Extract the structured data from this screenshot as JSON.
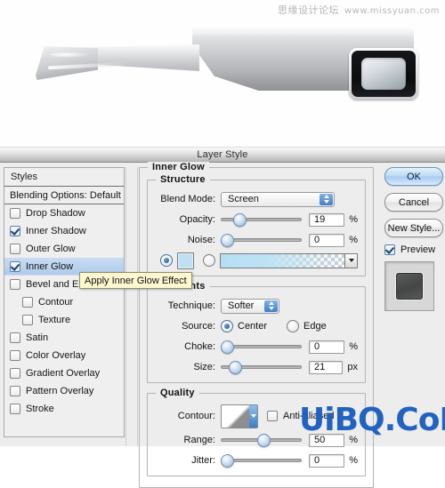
{
  "watermarks": {
    "top_cn": "思缘设计论坛",
    "top_url": "www.missyuan.com",
    "bottom": "UiBQ.CoM"
  },
  "dialog": {
    "title": "Layer Style"
  },
  "styles_panel": {
    "header": "Styles",
    "blending_options": "Blending Options: Default",
    "items": [
      {
        "label": "Drop Shadow",
        "checked": false,
        "indent": false,
        "selected": false
      },
      {
        "label": "Inner Shadow",
        "checked": true,
        "indent": false,
        "selected": false
      },
      {
        "label": "Outer Glow",
        "checked": false,
        "indent": false,
        "selected": false
      },
      {
        "label": "Inner Glow",
        "checked": true,
        "indent": false,
        "selected": true
      },
      {
        "label": "Bevel and Emboss",
        "checked": false,
        "indent": false,
        "selected": false
      },
      {
        "label": "Contour",
        "checked": false,
        "indent": true,
        "selected": false
      },
      {
        "label": "Texture",
        "checked": false,
        "indent": true,
        "selected": false
      },
      {
        "label": "Satin",
        "checked": false,
        "indent": false,
        "selected": false
      },
      {
        "label": "Color Overlay",
        "checked": false,
        "indent": false,
        "selected": false
      },
      {
        "label": "Gradient Overlay",
        "checked": false,
        "indent": false,
        "selected": false
      },
      {
        "label": "Pattern Overlay",
        "checked": false,
        "indent": false,
        "selected": false
      },
      {
        "label": "Stroke",
        "checked": false,
        "indent": false,
        "selected": false
      }
    ]
  },
  "tooltip": {
    "text": "Apply Inner Glow Effect"
  },
  "inner_glow": {
    "section_title": "Inner Glow",
    "structure": {
      "title": "Structure",
      "blend_mode_label": "Blend Mode:",
      "blend_mode_value": "Screen",
      "opacity_label": "Opacity:",
      "opacity_value": "19",
      "opacity_unit": "%",
      "noise_label": "Noise:",
      "noise_value": "0",
      "noise_unit": "%",
      "fill_type": "color",
      "color_hex": "#bfe0f2"
    },
    "elements": {
      "title": "Elements",
      "technique_label": "Technique:",
      "technique_value": "Softer",
      "source_label": "Source:",
      "source_center": "Center",
      "source_edge": "Edge",
      "source_selected": "Center",
      "choke_label": "Choke:",
      "choke_value": "0",
      "choke_unit": "%",
      "size_label": "Size:",
      "size_value": "21",
      "size_unit": "px"
    },
    "quality": {
      "title": "Quality",
      "contour_label": "Contour:",
      "anti_aliased_label": "Anti-aliased",
      "anti_aliased_checked": false,
      "range_label": "Range:",
      "range_value": "50",
      "range_unit": "%",
      "jitter_label": "Jitter:",
      "jitter_value": "0",
      "jitter_unit": "%"
    }
  },
  "buttons": {
    "ok": "OK",
    "cancel": "Cancel",
    "new_style": "New Style...",
    "preview_label": "Preview",
    "preview_checked": true
  }
}
